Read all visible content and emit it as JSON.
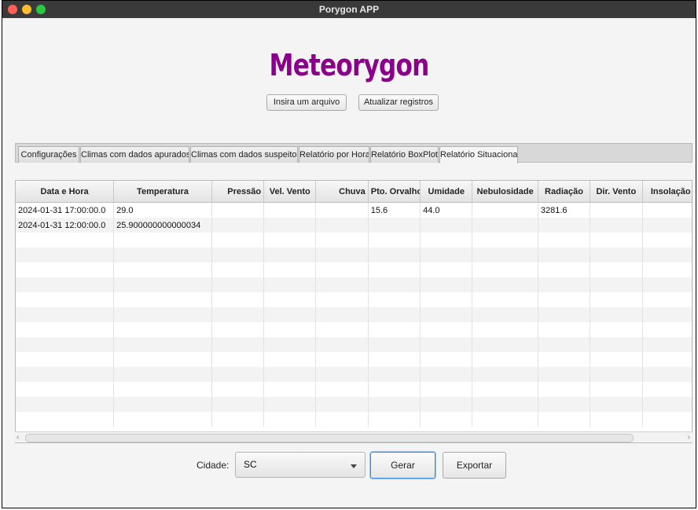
{
  "window": {
    "title": "Porygon APP"
  },
  "header": {
    "app_title": "Meteorygon"
  },
  "actions": {
    "insert_label": "Insira um arquivo",
    "update_label": "Atualizar registros"
  },
  "tabs": [
    {
      "label": "Configurações"
    },
    {
      "label": "Climas com dados apurados"
    },
    {
      "label": "Climas com dados suspeitos"
    },
    {
      "label": "Relatório por Hora"
    },
    {
      "label": "Relatório BoxPlot"
    },
    {
      "label": "Relatório Situacional",
      "active": true
    }
  ],
  "table": {
    "columns": [
      "Data e Hora",
      "Temperatura",
      "Pressão",
      "Vel. Vento",
      "Chuva",
      "Pto. Orvalho",
      "Umidade",
      "Nebulosidade",
      "Radiação",
      "Dir. Vento",
      "Insolação"
    ],
    "rows": [
      [
        "2024-01-31 17:00:00.0",
        "29.0",
        "",
        "",
        "",
        "15.6",
        "44.0",
        "",
        "3281.6",
        "",
        ""
      ],
      [
        "2024-01-31 12:00:00.0",
        "25.900000000000034",
        "",
        "",
        "",
        "",
        "",
        "",
        "",
        "",
        ""
      ]
    ],
    "empty_rows": 13
  },
  "footer": {
    "city_label": "Cidade:",
    "city_value": "SC",
    "generate_label": "Gerar",
    "export_label": "Exportar"
  },
  "icons": {
    "close": "traffic-light-red",
    "minimize": "traffic-light-yellow",
    "maximize": "traffic-light-green",
    "dropdown": "chevron-down-icon",
    "scroll_left": "chevron-left-icon",
    "scroll_right": "chevron-right-icon"
  },
  "colors": {
    "title": "#8b008b",
    "titlebar": "#3a3a3a",
    "focus": "#3d8bd8"
  }
}
